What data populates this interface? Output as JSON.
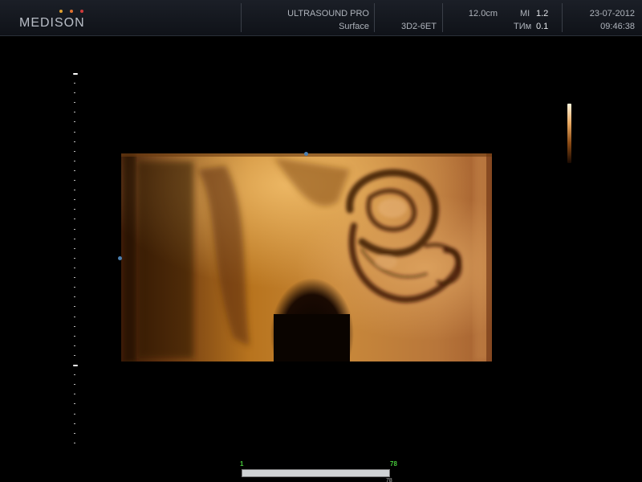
{
  "header": {
    "logo": {
      "text": "MEDISON",
      "dot_colors": [
        "#e0a030",
        "#e07030",
        "#d03a3a"
      ]
    },
    "system_name": "ULTRASOUND PRO",
    "mode": "Surface",
    "probe": "3D2-6ET",
    "depth": "12.0cm",
    "mi_label": "MI",
    "mi_value": "1.2",
    "tib_label": "TИм",
    "tib_value": "0.1",
    "date": "23-07-2012",
    "time": "09:46:38"
  },
  "image_area": {
    "render_description_icon": "3d-surface-render",
    "colorbar_colors": [
      "#fff4dc",
      "#e8a860",
      "#8a4a14",
      "#1a0a02"
    ]
  },
  "cine": {
    "start_label": "1",
    "end_label": "78",
    "current_label": "78",
    "position_fraction": 1.0
  }
}
